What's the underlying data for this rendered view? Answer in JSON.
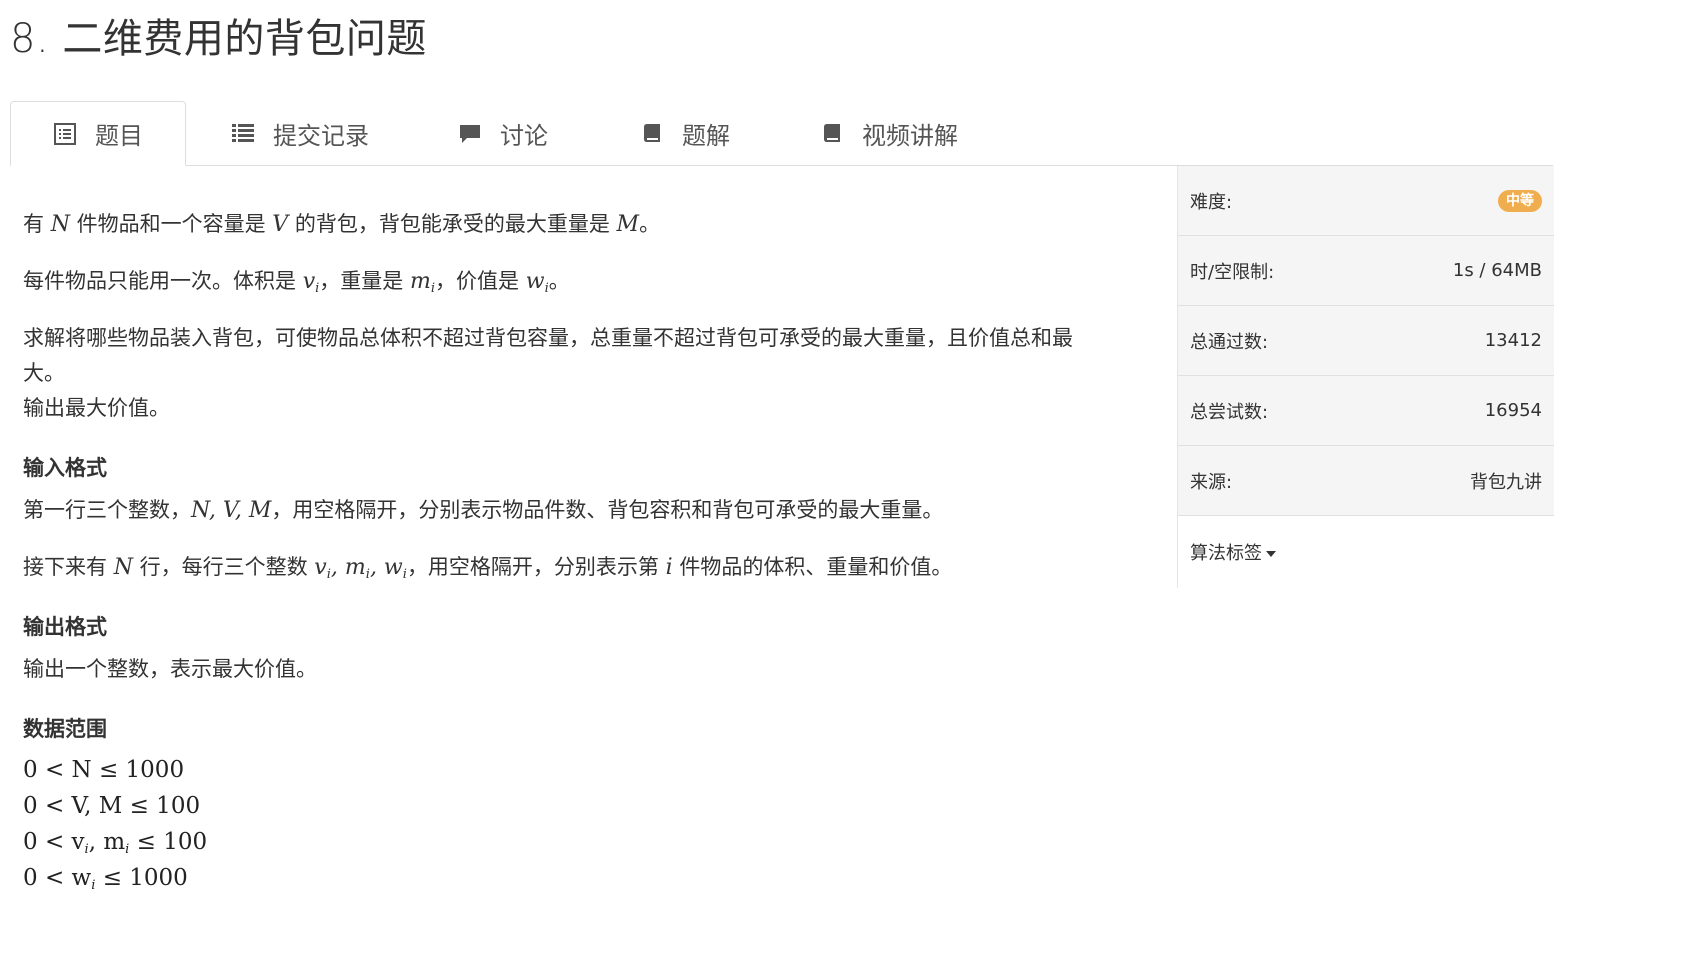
{
  "title": "8. 二维费用的背包问题",
  "tabs": [
    {
      "label": "题目",
      "icon": "list-alt-icon",
      "active": true
    },
    {
      "label": "提交记录",
      "icon": "list-icon",
      "active": false
    },
    {
      "label": "讨论",
      "icon": "comment-icon",
      "active": false
    },
    {
      "label": "题解",
      "icon": "book-icon",
      "active": false
    },
    {
      "label": "视频讲解",
      "icon": "book-icon",
      "active": false
    }
  ],
  "problem": {
    "p1_a": "有 ",
    "p1_N": "N",
    "p1_b": " 件物品和一个容量是 ",
    "p1_V": "V",
    "p1_c": " 的背包，背包能承受的最大重量是 ",
    "p1_M": "M",
    "p1_d": "。",
    "p2_a": "每件物品只能用一次。体积是 ",
    "p2_v": "v",
    "p2_b": "，重量是 ",
    "p2_m": "m",
    "p2_c": "，价值是 ",
    "p2_w": "w",
    "p2_d": "。",
    "sub_i": "i",
    "p3_line1": "求解将哪些物品装入背包，可使物品总体积不超过背包容量，总重量不超过背包可承受的最大重量，且价值总和最",
    "p3_line2": "大。",
    "p4": "输出最大价值。",
    "input_heading": "输入格式",
    "in1_a": "第一行三个整数，",
    "in1_math": "N, V, M",
    "in1_b": "，用空格隔开，分别表示物品件数、背包容积和背包可承受的最大重量。",
    "in2_a": "接下来有 ",
    "in2_N": "N",
    "in2_b": " 行，每行三个整数 ",
    "in2_c": "，用空格隔开，分别表示第 ",
    "in2_i": "i",
    "in2_d": " 件物品的体积、重量和价值。",
    "output_heading": "输出格式",
    "out1": "输出一个整数，表示最大价值。",
    "range_heading": "数据范围",
    "range1": "0 < N ≤ 1000",
    "range2": "0 < V, M ≤ 100",
    "range3_a": "0 < v",
    "range3_b": ", m",
    "range3_c": " ≤ 100",
    "range4_a": "0 < w",
    "range4_b": " ≤ 1000"
  },
  "sidebar": {
    "difficulty_label": "难度:",
    "difficulty_value": "中等",
    "limit_label": "时/空限制:",
    "limit_value": "1s / 64MB",
    "passed_label": "总通过数:",
    "passed_value": "13412",
    "tried_label": "总尝试数:",
    "tried_value": "16954",
    "source_label": "来源:",
    "source_value": "背包九讲",
    "tags_label": "算法标签"
  },
  "colors": {
    "badge": "#f0ad4e",
    "sidebar_bg": "#f5f5f5",
    "border": "#dddddd"
  }
}
